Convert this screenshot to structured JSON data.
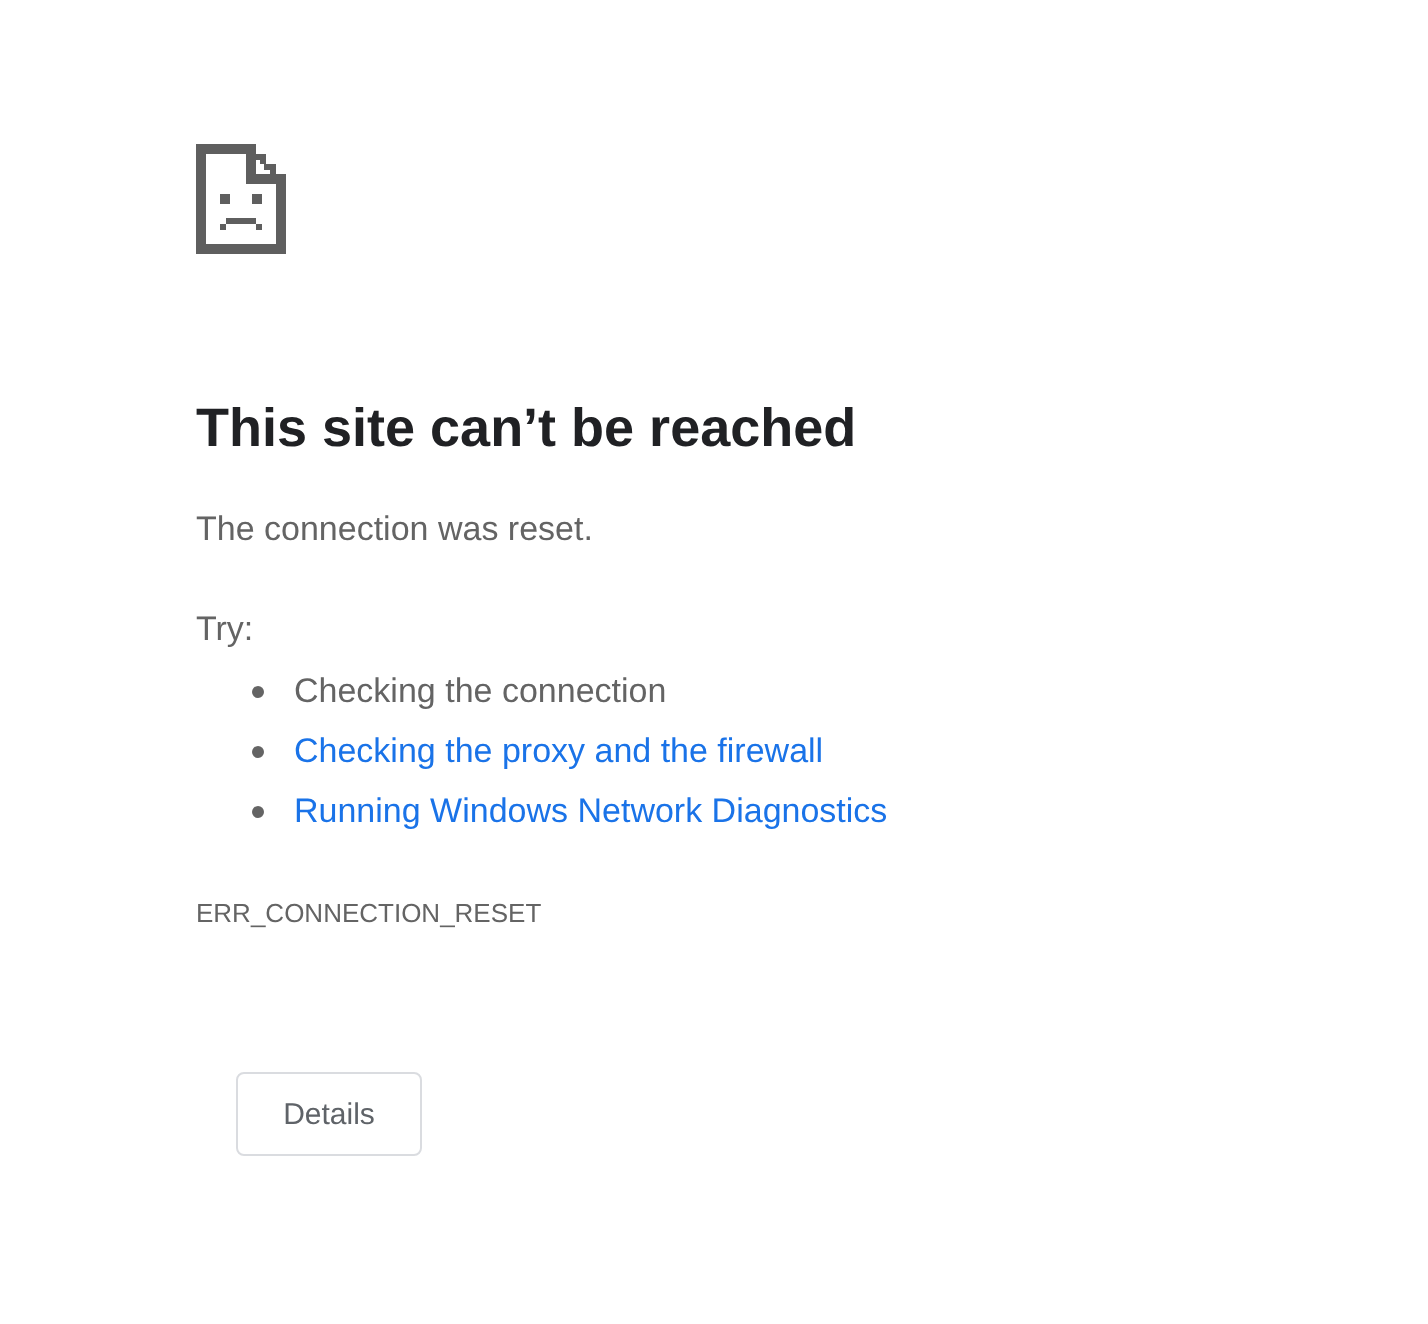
{
  "title": "This site can’t be reached",
  "message": "The connection was reset.",
  "try_label": "Try:",
  "suggestions": [
    {
      "text": "Checking the connection",
      "kind": "text"
    },
    {
      "text": "Checking the proxy and the firewall",
      "kind": "link"
    },
    {
      "text": "Running Windows Network Diagnostics",
      "kind": "link"
    }
  ],
  "error_code": "ERR_CONNECTION_RESET",
  "buttons": [
    "Details"
  ]
}
